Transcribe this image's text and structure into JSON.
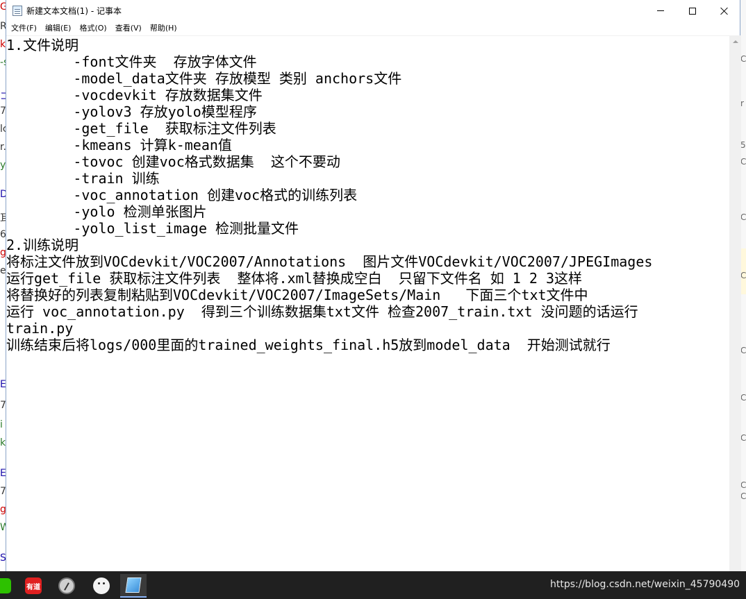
{
  "window": {
    "title": "新建文本文档(1) - 记事本"
  },
  "menu": [
    "文件(F)",
    "编辑(E)",
    "格式(O)",
    "查看(V)",
    "帮助(H)"
  ],
  "document_lines": [
    "1.文件说明",
    "        -font文件夹  存放字体文件",
    "        -model_data文件夹 存放模型 类别 anchors文件",
    "        -vocdevkit 存放数据集文件",
    "        -yolov3 存放yolo模型程序",
    "        -get_file  获取标注文件列表",
    "        -kmeans 计算k-mean值",
    "        -tovoc 创建voc格式数据集  这个不要动",
    "        -train 训练",
    "        -voc_annotation 创建voc格式的训练列表",
    "        -yolo 检测单张图片",
    "        -yolo_list_image 检测批量文件",
    "2.训练说明",
    "将标注文件放到VOCdevkit/VOC2007/Annotations  图片文件VOCdevkit/VOC2007/JPEGImages",
    "运行get_file 获取标注文件列表  整体将.xml替换成空白  只留下文件名 如 1 2 3这样",
    "将替换好的列表复制粘贴到VOCdevkit/VOC2007/ImageSets/Main   下面三个txt文件中",
    "运行 voc_annotation.py  得到三个训练数据集txt文件 检查2007_train.txt 没问题的话运行",
    "train.py",
    "训练结束后将logs/000里面的trained_weights_final.h5放到model_data  开始测试就行"
  ],
  "background_left": [
    "G",
    "R",
    "k",
    "-s",
    "ゴ",
    "7",
    "lc",
    "r.",
    "y",
    "D",
    "耳",
    "6",
    "g",
    "e",
    "E",
    "7",
    "i",
    "k",
    "E",
    "7",
    "g",
    "W",
    "S"
  ],
  "background_right": [
    "C",
    "r",
    "5",
    "C",
    "C",
    "C",
    "C",
    "C",
    "C",
    "C",
    "C"
  ],
  "taskbar": {
    "youdao_label": "有道",
    "watermark": "https://blog.csdn.net/weixin_45790490"
  },
  "colors": {
    "taskbar_bg": "#202020",
    "text": "#000000",
    "link_blue": "#1a0dab"
  }
}
